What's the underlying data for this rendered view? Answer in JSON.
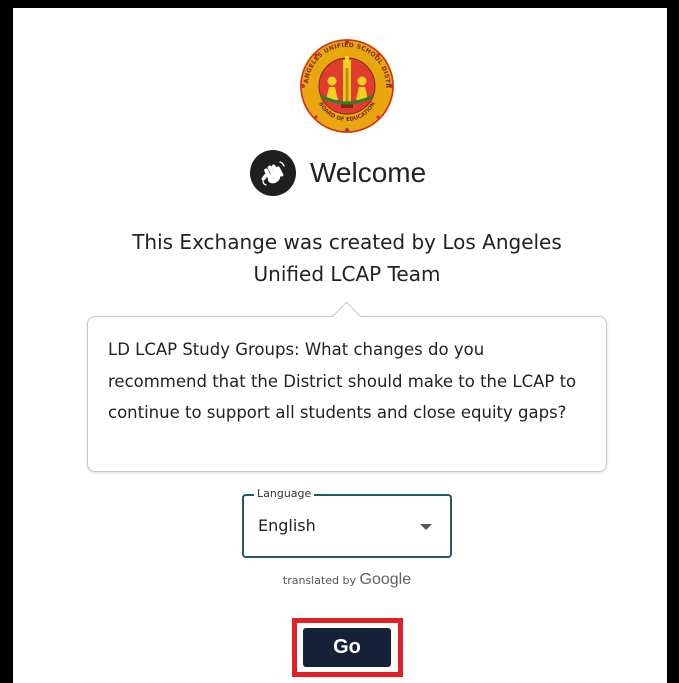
{
  "logo": {
    "icon": "lausd-seal-icon",
    "text_top": "LOS ANGELES UNIFIED SCHOOL DISTRICT",
    "text_bottom": "BOARD OF EDUCATION"
  },
  "welcome": {
    "icon": "waving-hand-icon",
    "title": "Welcome"
  },
  "creator": {
    "line1": "This Exchange was created by Los Angeles",
    "line2": "Unified LCAP Team"
  },
  "prompt": {
    "text": "LD LCAP Study Groups: What changes do you recommend that the District should make to the LCAP to continue to support all students and close equity gaps?"
  },
  "language_select": {
    "label": "Language",
    "selected": "English",
    "icon": "caret-down-icon"
  },
  "translation": {
    "prefix": "translated by",
    "brand": "Google"
  },
  "actions": {
    "go_label": "Go"
  },
  "colors": {
    "frame": "#000000",
    "go_button": "#152238",
    "highlight": "#e32027",
    "select_border": "#1e5c63",
    "seal_gold": "#e8a70f",
    "seal_red": "#d32b2b"
  }
}
